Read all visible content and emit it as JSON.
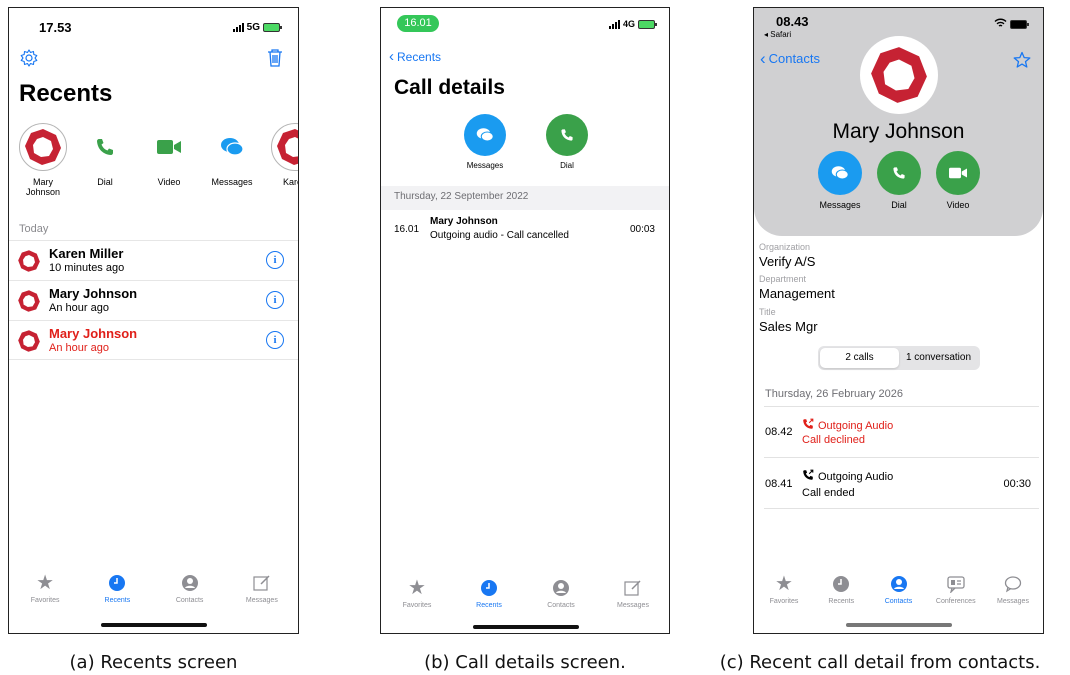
{
  "panel_a": {
    "status": {
      "time": "17.53",
      "network": "5G"
    },
    "title": "Recents",
    "quick_actions": [
      {
        "label": "Mary\nJohnson",
        "icon": "avatar-logo"
      },
      {
        "label": "Dial",
        "icon": "phone-icon"
      },
      {
        "label": "Video",
        "icon": "video-icon"
      },
      {
        "label": "Messages",
        "icon": "chat-icon"
      },
      {
        "label": "Karen",
        "icon": "avatar-logo"
      }
    ],
    "section": "Today",
    "rows": [
      {
        "name": "Karen Miller",
        "sub": "10 minutes ago",
        "missed": false
      },
      {
        "name": "Mary Johnson",
        "sub": "An hour ago",
        "missed": false
      },
      {
        "name": "Mary Johnson",
        "sub": "An hour ago",
        "missed": true
      }
    ],
    "info_glyph": "i",
    "tabs": [
      "Favorites",
      "Recents",
      "Contacts",
      "Messages"
    ],
    "active_tab": "Recents",
    "caption": "(a) Recents screen"
  },
  "panel_b": {
    "status": {
      "time": "16.01",
      "network": "4G"
    },
    "back": "Recents",
    "title": "Call details",
    "buttons": [
      {
        "label": "Messages",
        "color": "#1a9bf0"
      },
      {
        "label": "Dial",
        "color": "#3aa14a"
      }
    ],
    "date": "Thursday, 22 September 2022",
    "call": {
      "time": "16.01",
      "name": "Mary Johnson",
      "desc": "Outgoing audio - Call cancelled",
      "duration": "00:03"
    },
    "tabs": [
      "Favorites",
      "Recents",
      "Contacts",
      "Messages"
    ],
    "active_tab": "Recents",
    "caption": "(b) Call details screen."
  },
  "panel_c": {
    "status": {
      "time": "08.43",
      "back_app": "◂ Safari"
    },
    "back": "Contacts",
    "name": "Mary Johnson",
    "buttons": [
      {
        "label": "Messages",
        "color": "#1a9bf0"
      },
      {
        "label": "Dial",
        "color": "#3aa14a"
      },
      {
        "label": "Video",
        "color": "#3aa14a"
      }
    ],
    "fields": [
      {
        "label": "Organization",
        "value": "Verify A/S"
      },
      {
        "label": "Department",
        "value": "Management"
      },
      {
        "label": "Title",
        "value": "Sales Mgr"
      }
    ],
    "segments": [
      "2 calls",
      "1 conversation"
    ],
    "date": "Thursday, 26 February 2026",
    "calls": [
      {
        "time": "08.42",
        "type": "Outgoing Audio",
        "status": "Call declined",
        "duration": "",
        "failed": true
      },
      {
        "time": "08.41",
        "type": "Outgoing Audio",
        "status": "Call ended",
        "duration": "00:30",
        "failed": false
      }
    ],
    "tabs": [
      "Favorites",
      "Recents",
      "Contacts",
      "Conferences",
      "Messages"
    ],
    "active_tab": "Contacts",
    "caption": "(c) Recent call detail from contacts."
  },
  "colors": {
    "accent": "#1877f2",
    "missed": "#e0201a",
    "logo": "#c62233",
    "green": "#3aa14a",
    "blue_button": "#1a9bf0"
  }
}
